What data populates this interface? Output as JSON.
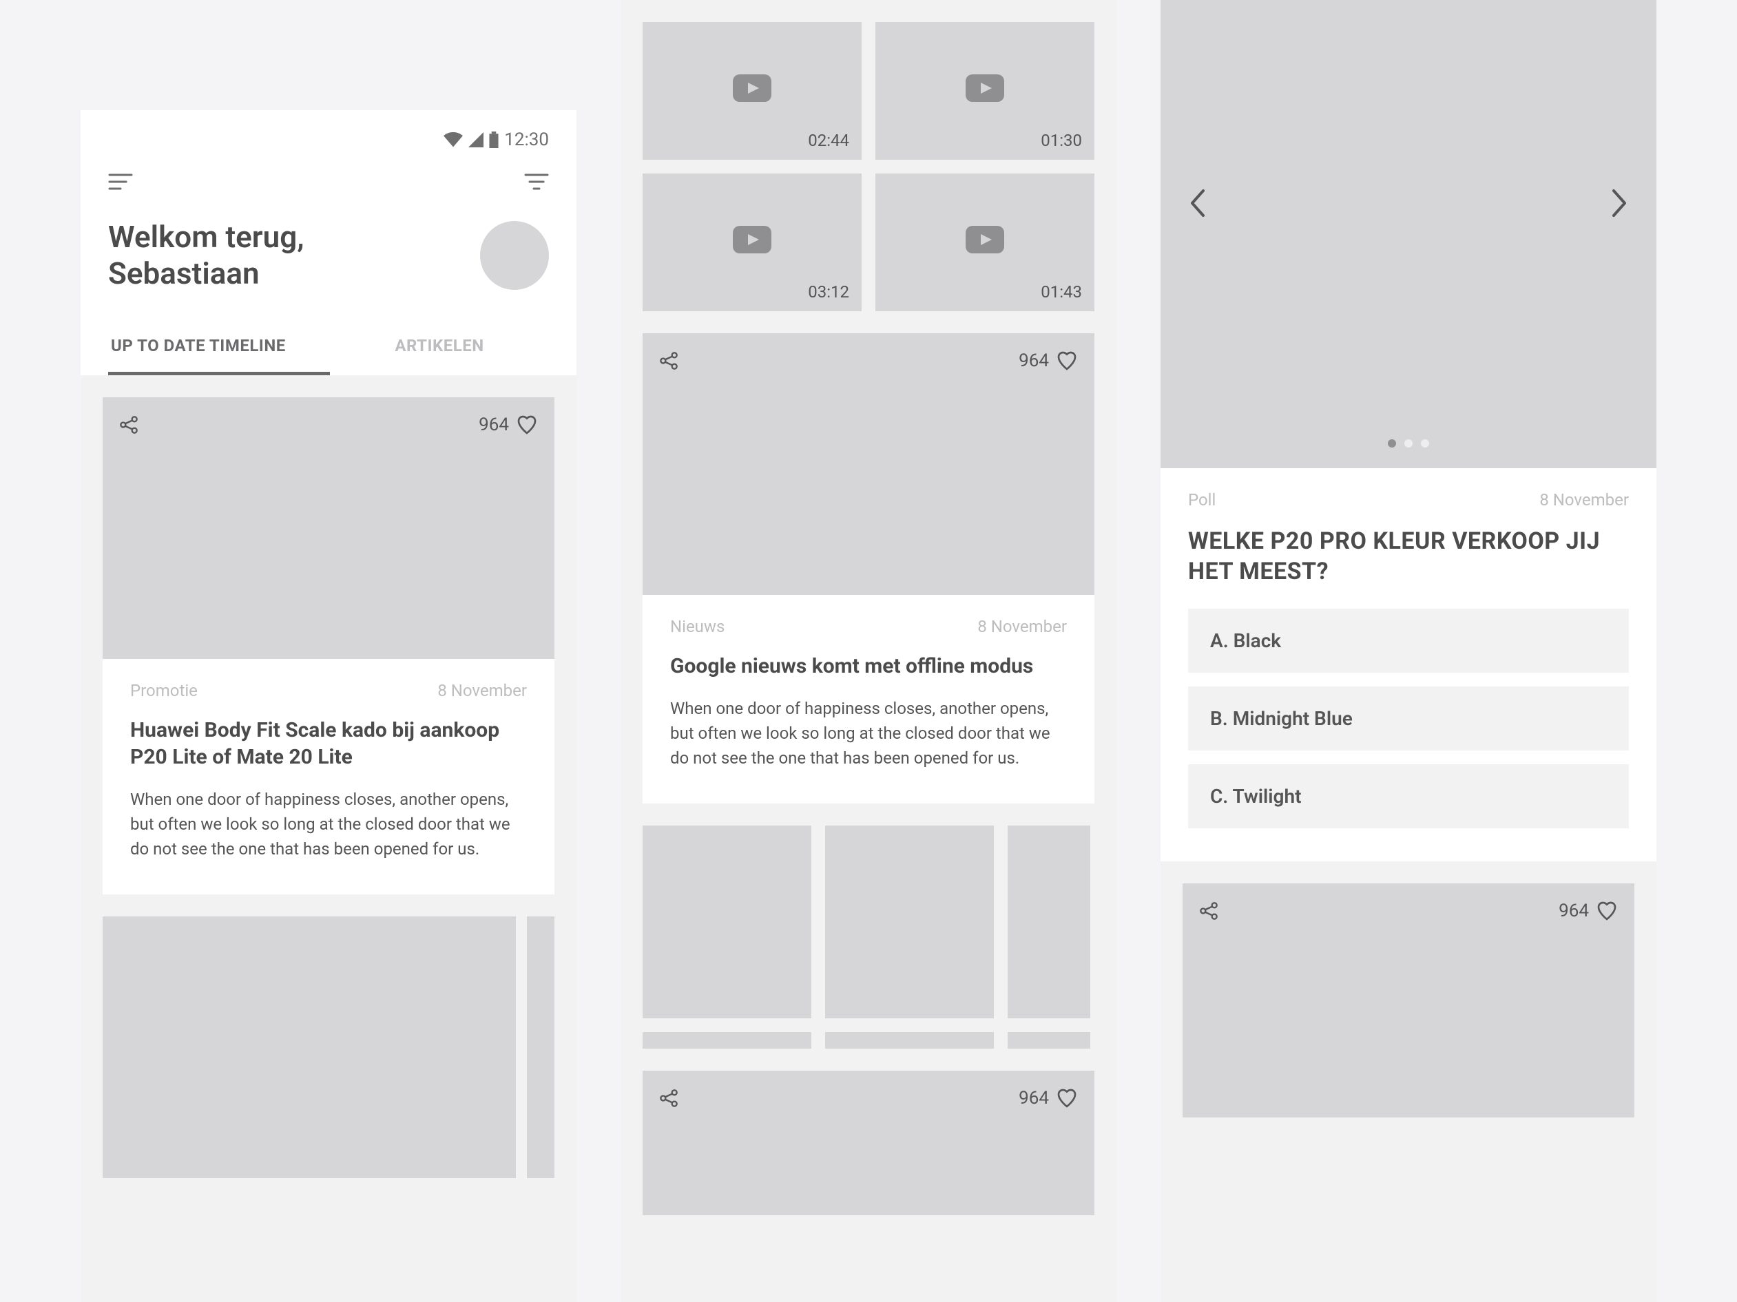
{
  "status": {
    "time": "12:30"
  },
  "header": {
    "welcome_line1": "Welkom terug,",
    "welcome_line2": "Sebastiaan"
  },
  "tabs": {
    "timeline": "UP TO DATE TIMELINE",
    "articles": "ARTIKELEN"
  },
  "promo": {
    "category": "Promotie",
    "date": "8 November",
    "title": "Huawei Body Fit Scale kado bij aankoop P20 Lite of Mate 20 Lite",
    "desc": "When one door of happiness closes, another opens, but often we look so long at the closed door that we do not see the one that has been opened for us.",
    "likes": "964"
  },
  "videos": [
    {
      "time": "02:44"
    },
    {
      "time": "01:30"
    },
    {
      "time": "03:12"
    },
    {
      "time": "01:43"
    }
  ],
  "news": {
    "category": "Nieuws",
    "date": "8 November",
    "title": "Google nieuws komt met offline modus",
    "desc": "When one door of happiness closes, another opens, but often we look so long at the closed door that we do not see the one that has been opened for us.",
    "likes": "964"
  },
  "extra_card": {
    "likes": "964"
  },
  "poll": {
    "category": "Poll",
    "date": "8 November",
    "title": "WELKE P20 PRO KLEUR VERKOOP JIJ HET MEEST?",
    "options": [
      "A. Black",
      "B. Midnight Blue",
      "C. Twilight"
    ]
  },
  "poll_extra": {
    "likes": "964"
  }
}
